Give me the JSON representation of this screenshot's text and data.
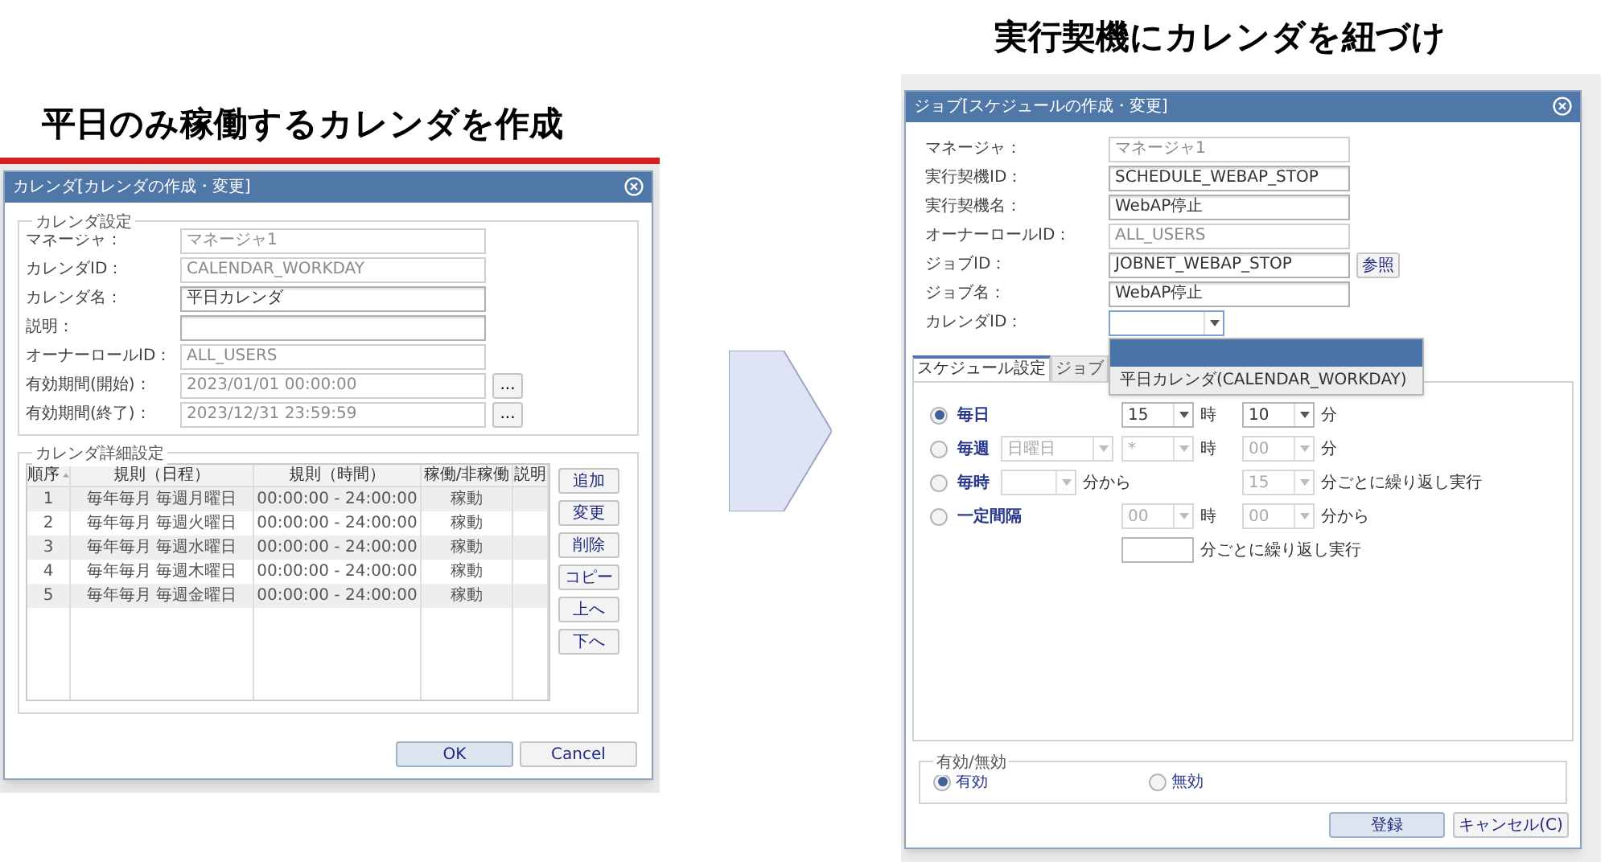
{
  "left_heading": "平日のみ稼働するカレンダを作成",
  "calendar_dialog": {
    "title": "カレンダ[カレンダの作成・変更]",
    "settings_group": {
      "legend": "カレンダ設定",
      "fields": [
        {
          "label": "マネージャ：",
          "value": "マネージャ1",
          "readonly": true
        },
        {
          "label": "カレンダID：",
          "value": "CALENDAR_WORKDAY",
          "readonly": true
        },
        {
          "label": "カレンダ名：",
          "value": "平日カレンダ",
          "readonly": false
        },
        {
          "label": "説明：",
          "readonly": false
        },
        {
          "label": "オーナーロールID：",
          "value": "ALL_USERS",
          "readonly": true
        },
        {
          "label": "有効期間(開始)：",
          "value": "2023/01/01 00:00:00",
          "readonly": true,
          "button": "..."
        },
        {
          "label": "有効期間(終了)：",
          "value": "2023/12/31 23:59:59",
          "readonly": true,
          "button": "..."
        }
      ]
    },
    "detail_group": {
      "legend": "カレンダ詳細設定",
      "columns": [
        "順序",
        "規則（日程）",
        "規則（時間）",
        "稼働/非稼働",
        "説明"
      ],
      "rows": [
        {
          "order": "1",
          "schedule": "毎年毎月 毎週月曜日",
          "time": "00:00:00 - 24:00:00",
          "state": "稼動"
        },
        {
          "order": "2",
          "schedule": "毎年毎月 毎週火曜日",
          "time": "00:00:00 - 24:00:00",
          "state": "稼動"
        },
        {
          "order": "3",
          "schedule": "毎年毎月 毎週水曜日",
          "time": "00:00:00 - 24:00:00",
          "state": "稼動"
        },
        {
          "order": "4",
          "schedule": "毎年毎月 毎週木曜日",
          "time": "00:00:00 - 24:00:00",
          "state": "稼動"
        },
        {
          "order": "5",
          "schedule": "毎年毎月 毎週金曜日",
          "time": "00:00:00 - 24:00:00",
          "state": "稼動"
        }
      ],
      "side_buttons": [
        "追加",
        "変更",
        "削除",
        "コピー",
        "上へ",
        "下へ"
      ]
    },
    "footer_buttons": [
      {
        "label": "OK",
        "default": true
      },
      {
        "label": "Cancel",
        "default": false
      }
    ]
  },
  "right_heading": "実行契機にカレンダを紐づけ",
  "schedule_dialog": {
    "title": "ジョブ[スケジュールの作成・変更]",
    "fields": [
      {
        "kind": "text",
        "label": "マネージャ：",
        "value": "マネージャ1",
        "readonly": true
      },
      {
        "kind": "text",
        "label": "実行契機ID：",
        "value": "SCHEDULE_WEBAP_STOP",
        "readonly": false
      },
      {
        "kind": "text",
        "label": "実行契機名：",
        "value": "WebAP停止",
        "readonly": false
      },
      {
        "kind": "text",
        "label": "オーナーロールID：",
        "value": "ALL_USERS",
        "readonly": true
      },
      {
        "kind": "text",
        "label": "ジョブID：",
        "value": "JOBNET_WEBAP_STOP",
        "readonly": false,
        "button": "参照"
      },
      {
        "kind": "text",
        "label": "ジョブ名：",
        "value": "WebAP停止",
        "readonly": false
      },
      {
        "kind": "dropdown",
        "label": "カレンダID：",
        "expanded": true,
        "options": [
          {
            "selected": true
          },
          {
            "label": "平日カレンダ(CALENDAR_WORKDAY)",
            "selected": false
          }
        ]
      }
    ],
    "tabs": [
      {
        "label": "スケジュール設定",
        "selected": true
      },
      {
        "label": "ジョブ",
        "selected": false
      }
    ],
    "schedule_rows": [
      {
        "label": "毎日",
        "selected": true,
        "cells": [
          null,
          {
            "kind": "select",
            "value": "15",
            "disabled": false,
            "suffix": "時"
          },
          {
            "kind": "select",
            "value": "10",
            "disabled": false,
            "suffix": "分"
          }
        ]
      },
      {
        "label": "毎週",
        "selected": false,
        "cells": [
          {
            "kind": "select",
            "value": "日曜日",
            "disabled": true
          },
          {
            "kind": "select",
            "value": "*",
            "disabled": true,
            "suffix": "時"
          },
          {
            "kind": "select",
            "value": "00",
            "disabled": true,
            "suffix": "分"
          }
        ]
      },
      {
        "label": "毎時",
        "selected": false,
        "cells": [
          {
            "kind": "select",
            "disabled": true,
            "suffix": "分から"
          },
          null,
          {
            "kind": "select",
            "value": "15",
            "disabled": true,
            "suffix": "分ごとに繰り返し実行"
          }
        ]
      },
      {
        "label": "一定間隔",
        "selected": false,
        "cells": [
          null,
          {
            "kind": "select",
            "value": "00",
            "disabled": true,
            "suffix": "時"
          },
          {
            "kind": "select",
            "value": "00",
            "disabled": true,
            "suffix": "分から"
          }
        ]
      },
      {
        "cells": [
          null,
          {
            "kind": "input",
            "disabled": false,
            "suffix": "分ごとに繰り返し実行"
          },
          null
        ]
      }
    ],
    "valid_group": {
      "legend": "有効/無効",
      "options": [
        {
          "label": "有効",
          "selected": true
        },
        {
          "label": "無効",
          "selected": false
        }
      ]
    },
    "footer_buttons": [
      {
        "label": "登録",
        "default": true
      },
      {
        "label": "キャンセル(C)",
        "default": false
      }
    ]
  }
}
